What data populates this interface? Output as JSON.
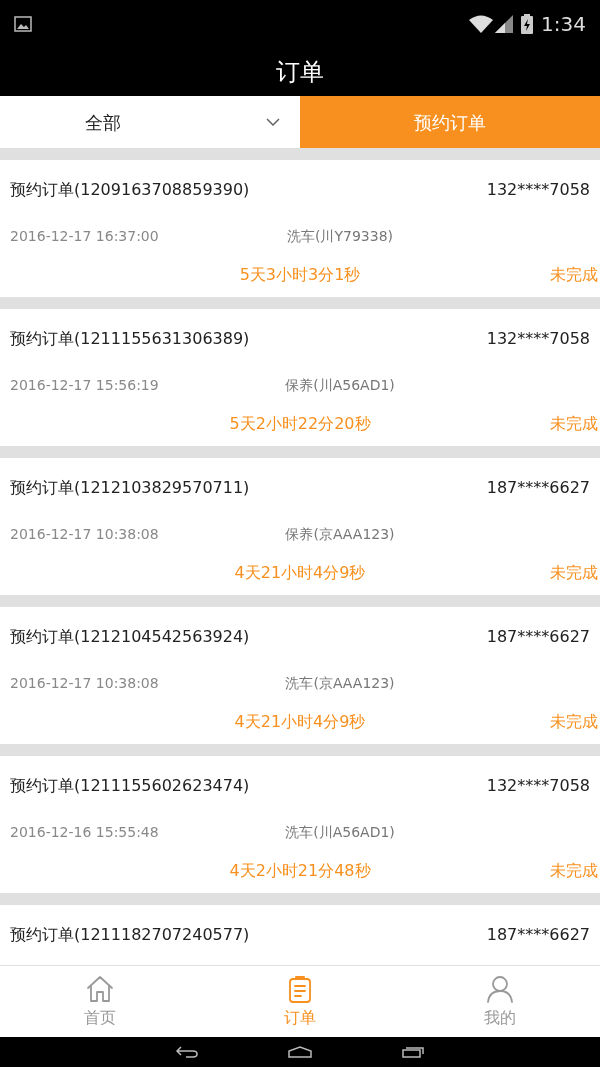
{
  "status_bar": {
    "time": "1:34"
  },
  "header": {
    "title": "订单"
  },
  "filter_tabs": [
    {
      "label": "全部",
      "kind": "dropdown",
      "selected": false
    },
    {
      "label": "预约订单",
      "kind": "tab",
      "selected": true
    }
  ],
  "orders": [
    {
      "title": "预约订单(1209163708859390)",
      "phone": "132****7058",
      "date": "2016-12-17 16:37:00",
      "service": "洗车(川Y79338)",
      "countdown": "5天3小时3分1秒",
      "status": "未完成"
    },
    {
      "title": "预约订单(1211155631306389)",
      "phone": "132****7058",
      "date": "2016-12-17 15:56:19",
      "service": "保养(川A56AD1)",
      "countdown": "5天2小时22分20秒",
      "status": "未完成"
    },
    {
      "title": "预约订单(1212103829570711)",
      "phone": "187****6627",
      "date": "2016-12-17 10:38:08",
      "service": "保养(京AAA123)",
      "countdown": "4天21小时4分9秒",
      "status": "未完成"
    },
    {
      "title": "预约订单(1212104542563924)",
      "phone": "187****6627",
      "date": "2016-12-17 10:38:08",
      "service": "洗车(京AAA123)",
      "countdown": "4天21小时4分9秒",
      "status": "未完成"
    },
    {
      "title": "预约订单(1211155602623474)",
      "phone": "132****7058",
      "date": "2016-12-16 15:55:48",
      "service": "洗车(川A56AD1)",
      "countdown": "4天2小时21分48秒",
      "status": "未完成"
    },
    {
      "title": "预约订单(1211182707240577)",
      "phone": "187****6627"
    }
  ],
  "bottom_nav": [
    {
      "label": "首页",
      "kind": "home",
      "selected": false
    },
    {
      "label": "订单",
      "kind": "orders",
      "selected": true
    },
    {
      "label": "我的",
      "kind": "profile",
      "selected": false
    }
  ]
}
